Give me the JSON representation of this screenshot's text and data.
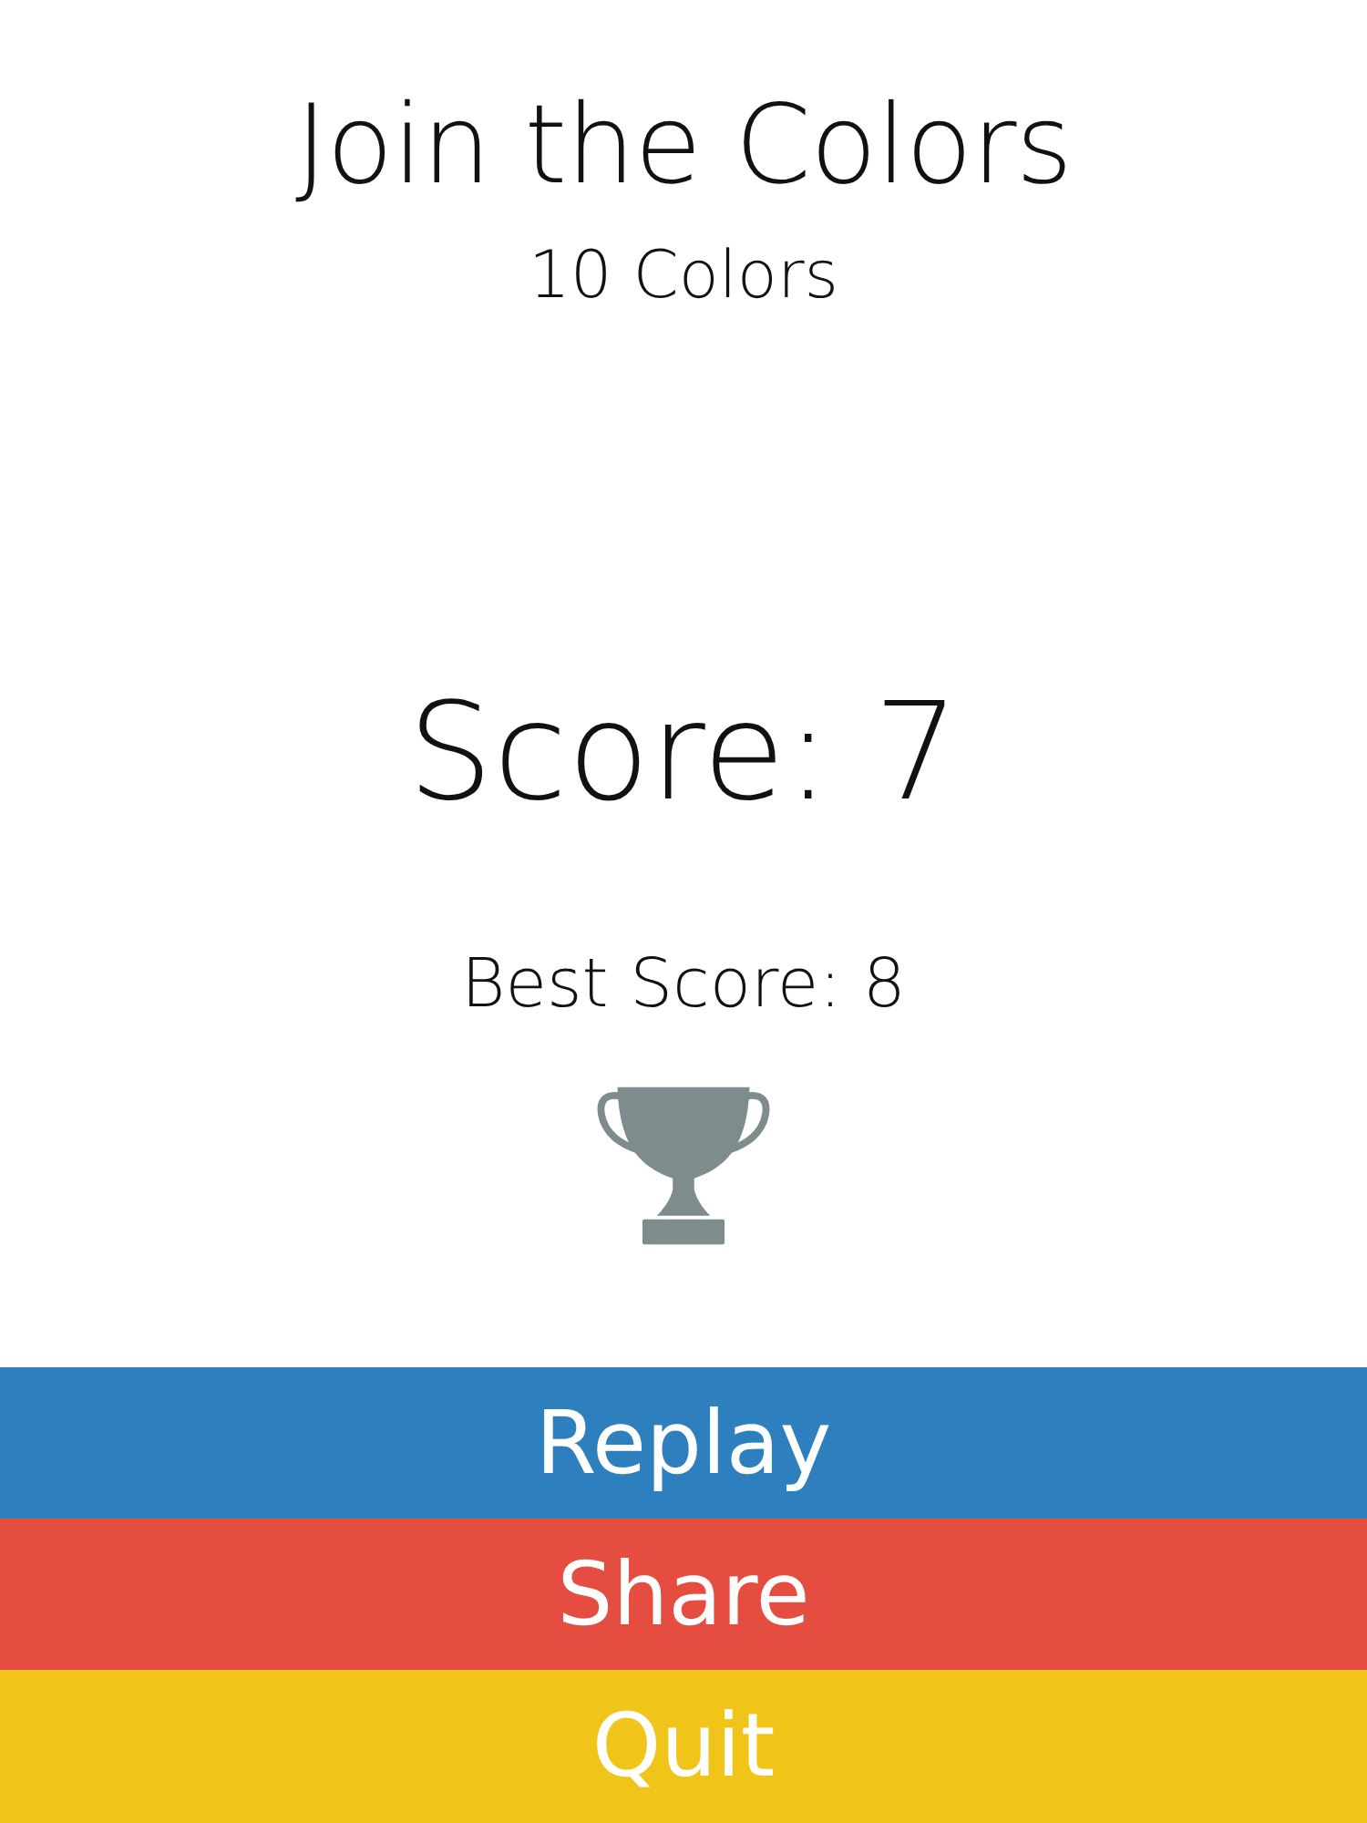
{
  "title": "Join the Colors",
  "subtitle": "10 Colors",
  "score": "Score: 7",
  "best_score": "Best Score: 8",
  "buttons": [
    {
      "label": "Replay",
      "color": "#2e7fbd"
    },
    {
      "label": "Share",
      "color": "#e44d3f"
    },
    {
      "label": "Quit",
      "color": "#f0c419"
    }
  ]
}
